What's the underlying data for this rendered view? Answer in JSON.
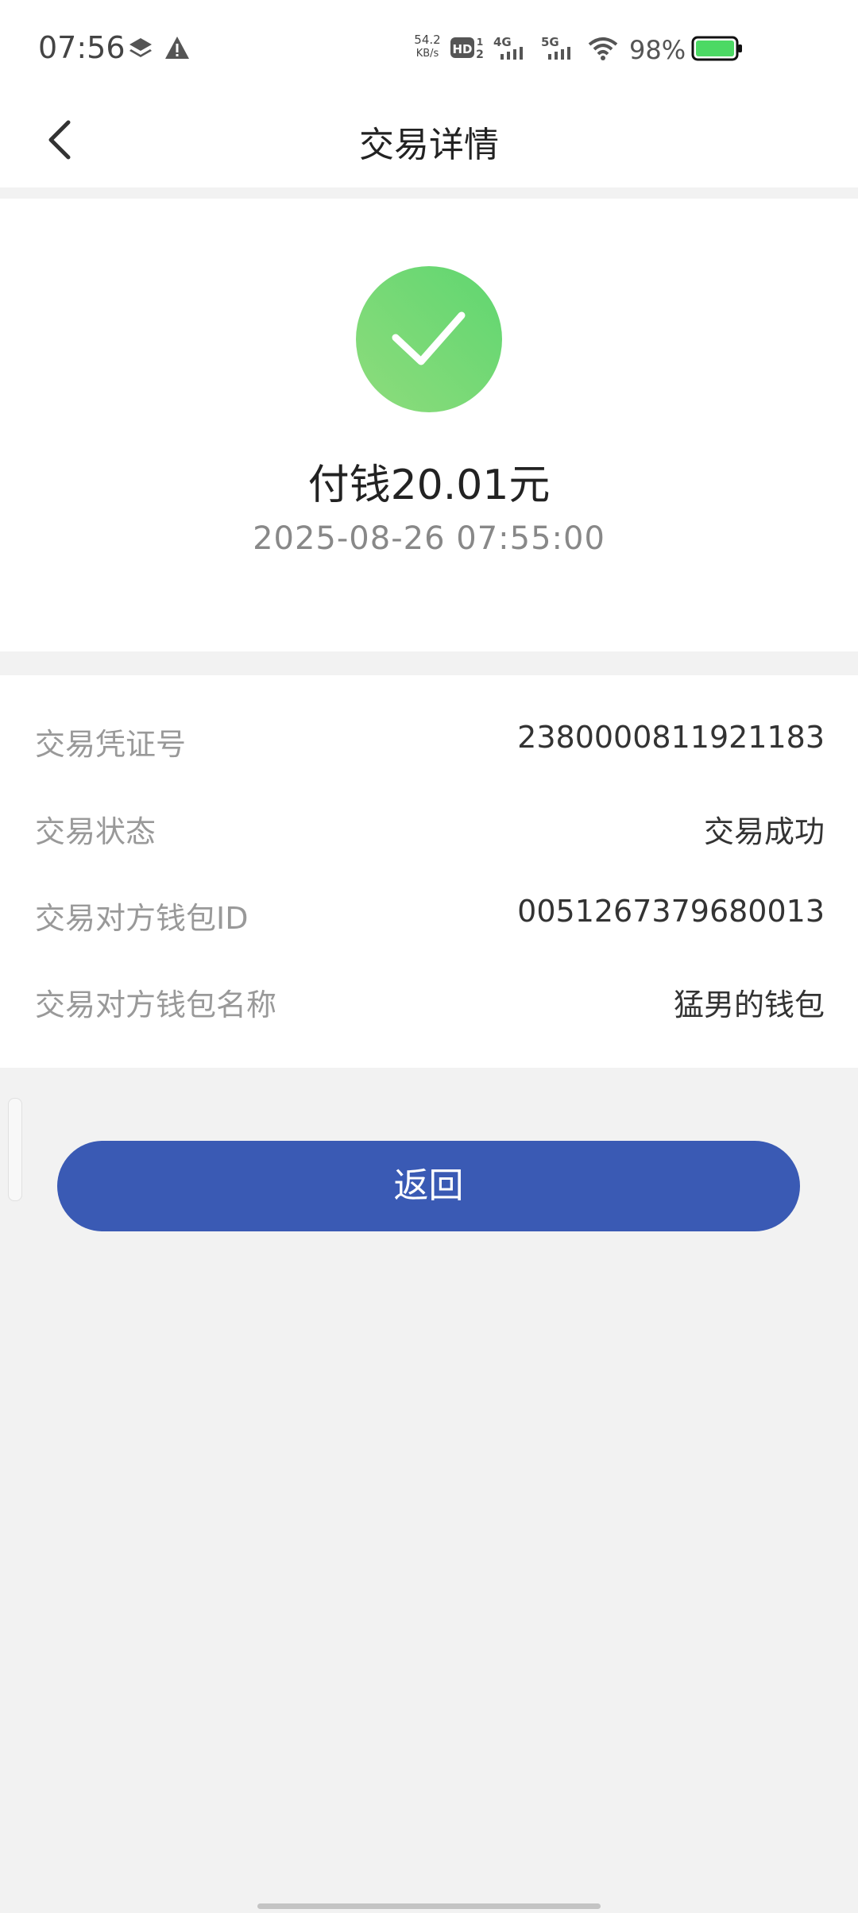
{
  "status_bar": {
    "time": "07:56",
    "net_speed_value": "54.2",
    "net_speed_unit": "KB/s",
    "hd_badge": "HD",
    "hd_index_top": "1",
    "hd_index_bottom": "2",
    "signal_4g_label": "4G",
    "signal_5g_label": "5G",
    "battery_percent": "98%",
    "battery_color": "#4cd964",
    "icons": [
      "layers-icon",
      "warning-icon",
      "hd-icon",
      "signal-4g-icon",
      "signal-5g-icon",
      "wifi-icon",
      "battery-icon"
    ]
  },
  "header": {
    "title": "交易详情",
    "back_icon": "chevron-left-icon"
  },
  "result": {
    "icon": "check-circle-icon",
    "icon_color": "#66d66e",
    "amount_text": "付钱20.01元",
    "datetime": "2025-08-26 07:55:00"
  },
  "details": [
    {
      "label": "交易凭证号",
      "value": "2380000811921183"
    },
    {
      "label": "交易状态",
      "value": "交易成功"
    },
    {
      "label": "交易对方钱包ID",
      "value": "0051267379680013"
    },
    {
      "label": "交易对方钱包名称",
      "value": "猛男的钱包"
    }
  ],
  "actions": {
    "return_label": "返回",
    "return_color": "#3a5ab4"
  }
}
